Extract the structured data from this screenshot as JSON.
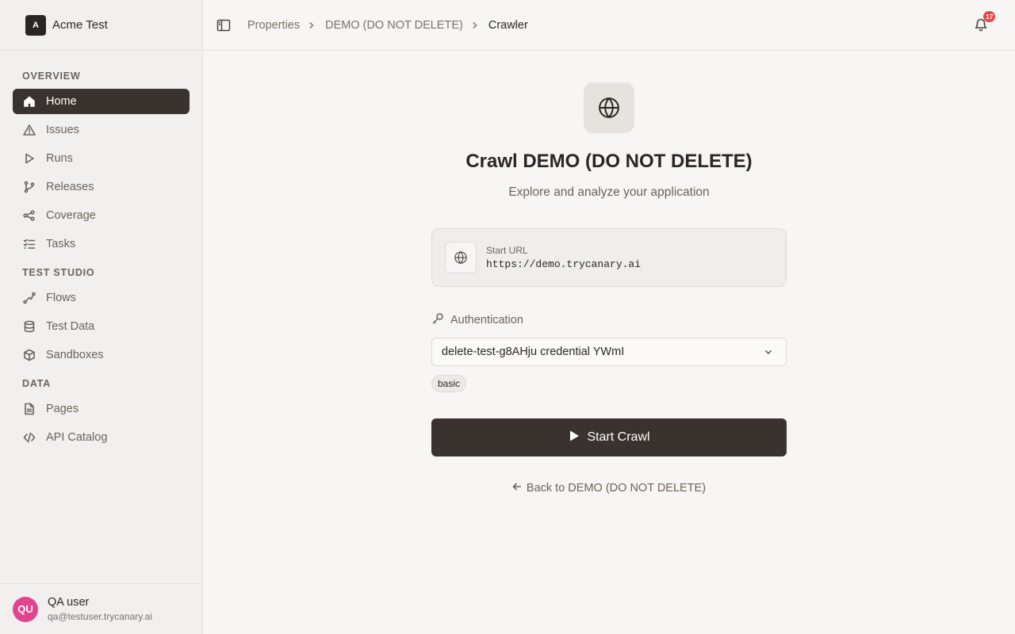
{
  "brand": {
    "logo_text": "A",
    "name": "Acme Test"
  },
  "sidebar": {
    "sections": [
      {
        "title": "OVERVIEW",
        "items": [
          {
            "label": "Home",
            "icon": "home-icon",
            "active": true
          },
          {
            "label": "Issues",
            "icon": "warning-icon"
          },
          {
            "label": "Runs",
            "icon": "play-icon"
          },
          {
            "label": "Releases",
            "icon": "git-branch-icon"
          },
          {
            "label": "Coverage",
            "icon": "network-icon"
          },
          {
            "label": "Tasks",
            "icon": "checklist-icon"
          }
        ]
      },
      {
        "title": "TEST STUDIO",
        "items": [
          {
            "label": "Flows",
            "icon": "flow-icon"
          },
          {
            "label": "Test Data",
            "icon": "database-icon"
          },
          {
            "label": "Sandboxes",
            "icon": "box-icon"
          }
        ]
      },
      {
        "title": "DATA",
        "items": [
          {
            "label": "Pages",
            "icon": "file-icon"
          },
          {
            "label": "API Catalog",
            "icon": "code-icon"
          }
        ]
      }
    ]
  },
  "user": {
    "initials": "QU",
    "name": "QA user",
    "email": "qa@testuser.trycanary.ai",
    "avatar_color": "#e3448f"
  },
  "header": {
    "breadcrumbs": [
      "Properties",
      "DEMO (DO NOT DELETE)",
      "Crawler"
    ],
    "notification_count": "17"
  },
  "main": {
    "title": "Crawl DEMO (DO NOT DELETE)",
    "subtitle": "Explore and analyze your application",
    "start_url_label": "Start URL",
    "start_url_value": "https://demo.trycanary.ai",
    "auth_label": "Authentication",
    "auth_selected": "delete-test-g8AHju credential YWmI",
    "auth_type_tag": "basic",
    "start_button": "Start Crawl",
    "back_link": "Back to DEMO (DO NOT DELETE)"
  },
  "colors": {
    "accent": "#3a322e",
    "badge": "#e5484d",
    "background": "#f7f6f4"
  }
}
